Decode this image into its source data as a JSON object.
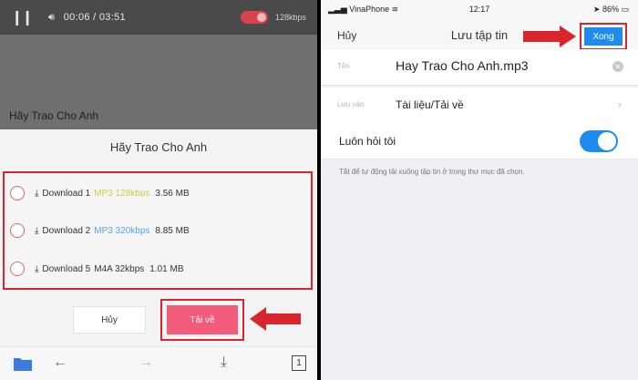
{
  "left": {
    "player": {
      "current_time": "00:06",
      "separator": "/",
      "total_time": "03:51",
      "bitrate": "128kbps",
      "video_title": "Hãy Trao Cho Anh"
    },
    "sheet": {
      "title": "Hãy Trao Cho Anh",
      "options": [
        {
          "label": "Download 1",
          "quality": "MP3 128kbps",
          "size": "3.56 MB",
          "quality_color": "yellow"
        },
        {
          "label": "Download 2",
          "quality": "MP3 320kbps",
          "size": "8.85 MB",
          "quality_color": "blue"
        },
        {
          "label": "Download 5",
          "quality": "M4A 32kbps",
          "size": "1.01 MB",
          "quality_color": "plain"
        }
      ],
      "cancel_label": "Hủy",
      "download_label": "Tải về"
    },
    "nav": {
      "tabs_count": "1"
    }
  },
  "right": {
    "status": {
      "carrier": "VinaPhone",
      "time": "12:17",
      "battery": "86%"
    },
    "navbar": {
      "cancel_label": "Hủy",
      "title": "Lưu tập tin",
      "done_label": "Xong"
    },
    "filename": {
      "label": "Tên",
      "value": "Hay Trao Cho Anh.mp3"
    },
    "location": {
      "label": "Lưu vào",
      "value": "Tài liệu/Tải về"
    },
    "always_ask": {
      "label": "Luôn hỏi tôi",
      "enabled": true
    },
    "hint": "Tắt để tự động tải xuống tập tin ở trong thư mục đã chọn."
  },
  "colors": {
    "highlight_red": "#d9262e",
    "accent_pink": "#f25c7a",
    "accent_blue": "#1e8bf0"
  }
}
